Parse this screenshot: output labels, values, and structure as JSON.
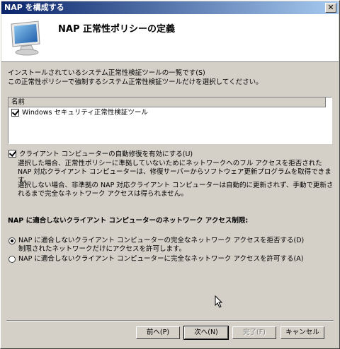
{
  "window": {
    "title": "NAP を構成する",
    "close_glyph": "✕"
  },
  "header": {
    "title": "NAP 正常性ポリシーの定義"
  },
  "intro": {
    "line1": "インストールされているシステム正常性検証ツールの一覧です(S)",
    "line2": "この正常性ポリシーで強制するシステム正常性検証ツールだけを選択してください。"
  },
  "list": {
    "column_header": "名前",
    "items": [
      {
        "label": "Windows セキュリティ正常性検証ツール",
        "checked": true
      }
    ]
  },
  "auto_remediation": {
    "label": "クライアント コンピューターの自動修復を有効にする(U)",
    "checked": true,
    "desc_selected": "選択した場合、正常性ポリシーに準拠していないためにネットワークへのフル アクセスを拒否された NAP 対応クライアント コンピューターは、修復サーバーからソフトウェア更新プログラムを取得できます。",
    "desc_unselected": "選択しない場合、非準拠の NAP 対応クライアント コンピューターは自動的に更新されず、手動で更新されるまで完全なネットワーク アクセスは得られません。"
  },
  "access_section": {
    "title": "NAP に適合しないクライアント コンピューターのネットワーク アクセス制限:",
    "option_deny_label": "NAP に適合しないクライアント コンピューターの完全なネットワーク アクセスを拒否する(D)",
    "option_deny_sub": "制限されたネットワークだけにアクセスを許可します。",
    "option_allow_label": "NAP に適合しないクライアント コンピューターに完全なネットワーク アクセスを許可する(A)",
    "selected": "deny"
  },
  "buttons": {
    "prev": "前へ(P)",
    "next": "次へ(N)",
    "finish": "完了(F)",
    "cancel": "キャンセル"
  }
}
